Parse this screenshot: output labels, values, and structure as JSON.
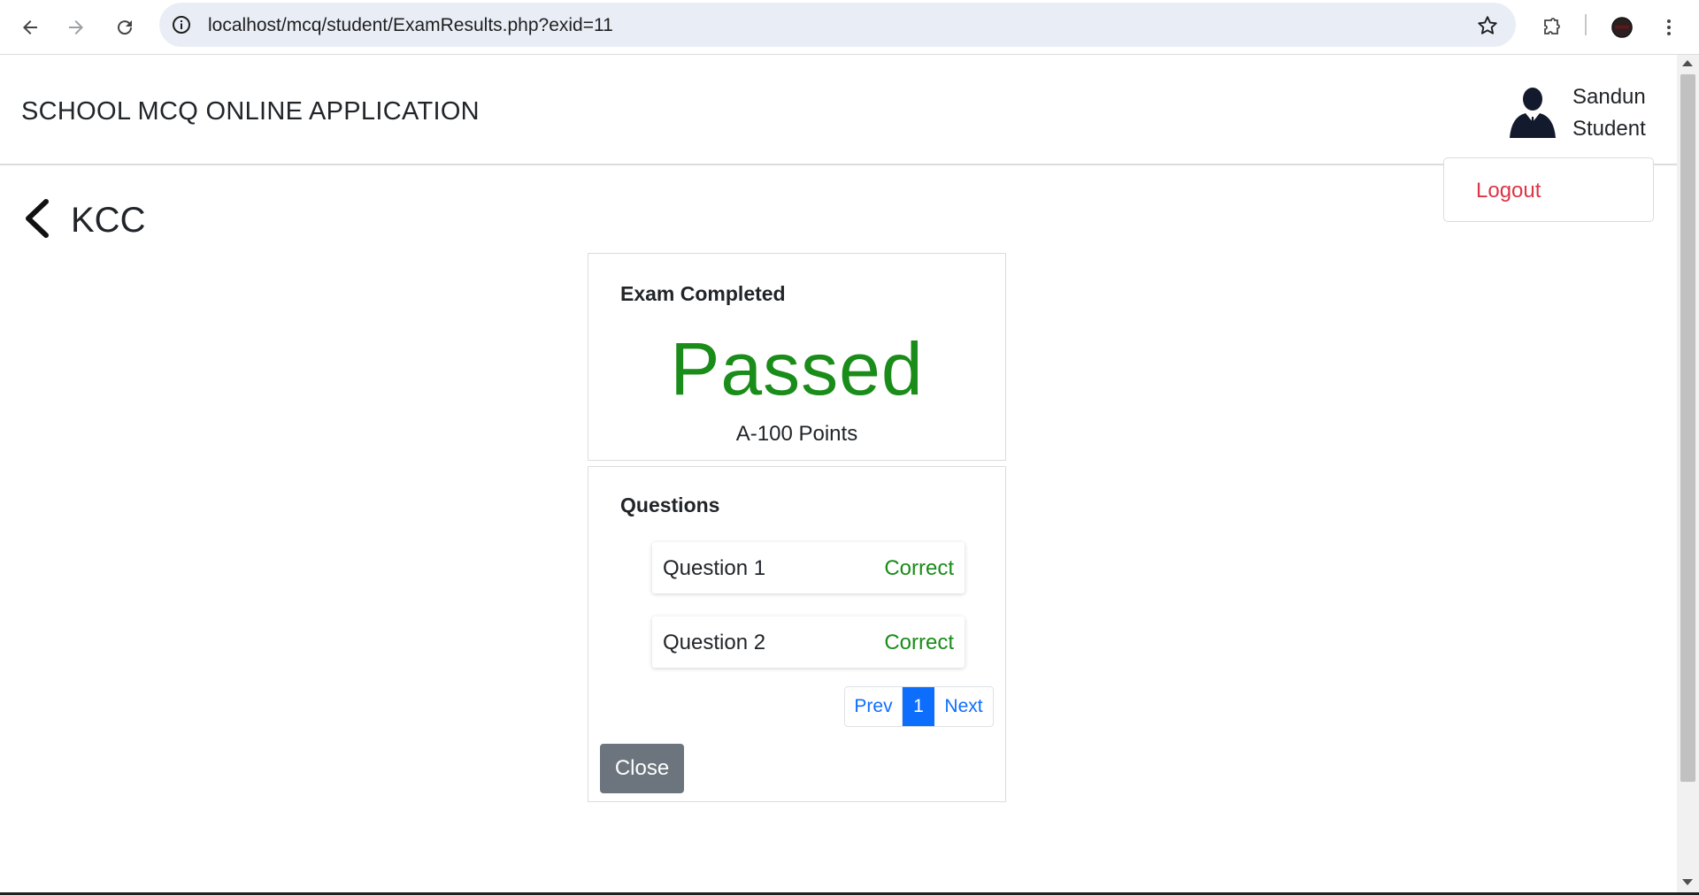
{
  "browser": {
    "url": "localhost/mcq/student/ExamResults.php?exid=11"
  },
  "navbar": {
    "brand": "SCHOOL MCQ ONLINE APPLICATION",
    "user_first_name": "Sandun",
    "user_role": "Student",
    "dropdown": {
      "logout_label": "Logout"
    }
  },
  "page": {
    "exam_title": "KCC"
  },
  "result_card": {
    "heading": "Exam Completed",
    "status": "Passed",
    "points": "A-100 Points"
  },
  "questions_card": {
    "heading": "Questions",
    "items": [
      {
        "label": "Question 1",
        "status": "Correct"
      },
      {
        "label": "Question 2",
        "status": "Correct"
      }
    ],
    "pagination": {
      "prev": "Prev",
      "current": "1",
      "next": "Next"
    },
    "close_label": "Close"
  },
  "colors": {
    "pass_green": "#198c19",
    "logout_red": "#dc3545",
    "link_blue": "#0d6efd",
    "close_gray": "#6c757d"
  }
}
